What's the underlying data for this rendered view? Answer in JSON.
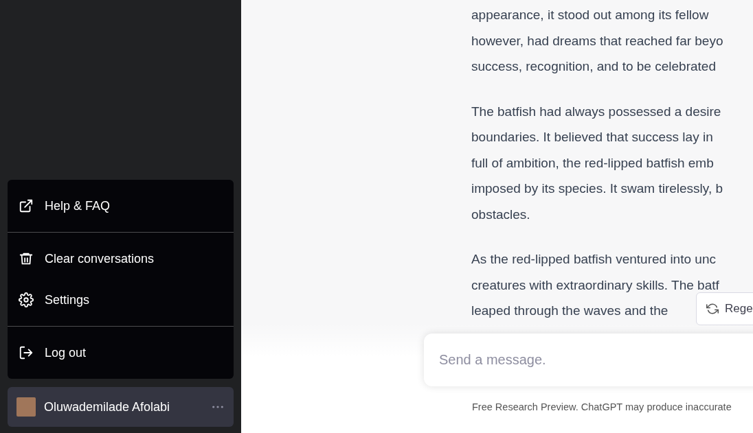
{
  "sidebar": {
    "menu": [
      {
        "kind": "external",
        "label": "Help & FAQ",
        "divider_after": true
      },
      {
        "kind": "trash",
        "label": "Clear conversations",
        "divider_after": false
      },
      {
        "kind": "gear",
        "label": "Settings",
        "divider_after": true
      },
      {
        "kind": "logout",
        "label": "Log out",
        "divider_after": false
      }
    ],
    "user": {
      "name": "Oluwademilade Afolabi"
    }
  },
  "conversation": {
    "paragraphs": [
      [
        "appearance, it stood out among its fellow",
        "however, had dreams that reached far beyo",
        "success, recognition, and to be celebrated"
      ],
      [
        "The batfish had always possessed a desire",
        "boundaries. It believed that success lay in",
        "full of ambition, the red-lipped batfish emb",
        "imposed by its species. It swam tirelessly, b",
        "obstacles."
      ],
      [
        "As the red-lipped batfish ventured into unc",
        "creatures with extraordinary skills. The batf",
        "leaped through the waves and the"
      ]
    ],
    "regenerate_button": "Rege"
  },
  "composer": {
    "placeholder": "Send a message."
  },
  "footer": "Free Research Preview. ChatGPT may produce inaccurate"
}
